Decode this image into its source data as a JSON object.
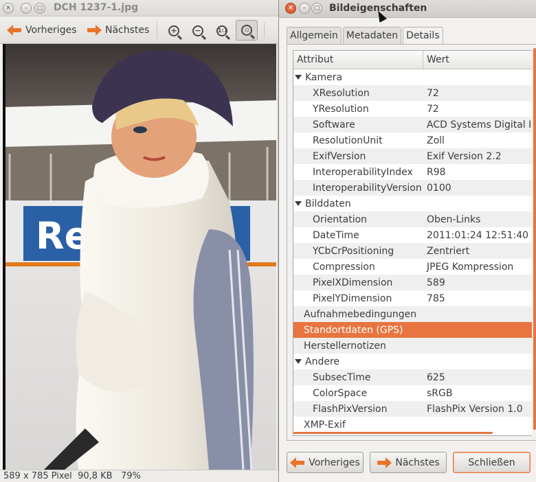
{
  "viewer": {
    "title": "DCH 1237-1.jpg",
    "toolbar": {
      "prev_label": "Vorheriges",
      "next_label": "Nächstes"
    },
    "status": {
      "dimensions": "589 x 785 Pixel",
      "size": "90,8 KB",
      "zoom": "79%"
    },
    "photo": {
      "banner_text": "Reeb"
    }
  },
  "dialog": {
    "title": "Bildeigenschaften",
    "tabs": [
      {
        "label": "Allgemein",
        "active": false
      },
      {
        "label": "Metadaten",
        "active": false
      },
      {
        "label": "Details",
        "active": true
      }
    ],
    "columns": {
      "attribute": "Attribut",
      "value": "Wert"
    },
    "rows": [
      {
        "type": "group",
        "expanded": true,
        "attr": "Kamera",
        "value": ""
      },
      {
        "type": "child",
        "attr": "XResolution",
        "value": "72"
      },
      {
        "type": "child",
        "attr": "YResolution",
        "value": "72"
      },
      {
        "type": "child",
        "attr": "Software",
        "value": "ACD Systems Digital I"
      },
      {
        "type": "child",
        "attr": "ResolutionUnit",
        "value": "Zoll"
      },
      {
        "type": "child",
        "attr": "ExifVersion",
        "value": "Exif Version 2.2"
      },
      {
        "type": "child",
        "attr": "InteroperabilityIndex",
        "value": "R98"
      },
      {
        "type": "child",
        "attr": "InteroperabilityVersion",
        "value": "0100"
      },
      {
        "type": "group",
        "expanded": true,
        "attr": "Bilddaten",
        "value": ""
      },
      {
        "type": "child",
        "attr": "Orientation",
        "value": "Oben-Links"
      },
      {
        "type": "child",
        "attr": "DateTime",
        "value": "2011:01:24 12:51:40"
      },
      {
        "type": "child",
        "attr": "YCbCrPositioning",
        "value": "Zentriert"
      },
      {
        "type": "child",
        "attr": "Compression",
        "value": "JPEG Kompression"
      },
      {
        "type": "child",
        "attr": "PixelXDimension",
        "value": "589"
      },
      {
        "type": "child",
        "attr": "PixelYDimension",
        "value": "785"
      },
      {
        "type": "group",
        "expanded": false,
        "attr": "Aufnahmebedingungen",
        "value": ""
      },
      {
        "type": "group",
        "expanded": false,
        "selected": true,
        "attr": "Standortdaten (GPS)",
        "value": ""
      },
      {
        "type": "group",
        "expanded": false,
        "attr": "Herstellernotizen",
        "value": ""
      },
      {
        "type": "group",
        "expanded": true,
        "attr": "Andere",
        "value": ""
      },
      {
        "type": "child",
        "attr": "SubsecTime",
        "value": "625"
      },
      {
        "type": "child",
        "attr": "ColorSpace",
        "value": "sRGB"
      },
      {
        "type": "child",
        "attr": "FlashPixVersion",
        "value": "FlashPix Version 1.0"
      },
      {
        "type": "group",
        "expanded": false,
        "attr": "XMP-Exif",
        "value": ""
      }
    ],
    "buttons": {
      "prev_label": "Vorheriges",
      "next_label": "Nächstes",
      "close_label": "Schließen"
    },
    "accent_color": "#e8743f"
  }
}
